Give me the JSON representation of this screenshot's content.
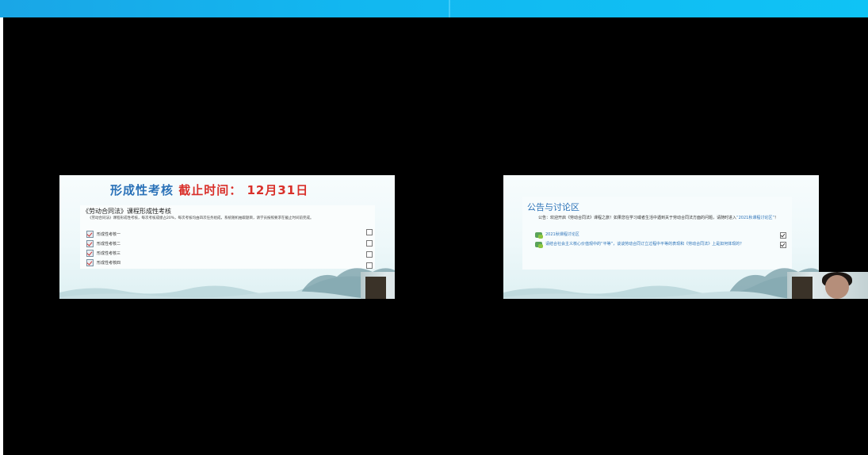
{
  "left_slide": {
    "title_main": "形成性考核",
    "title_deadline": "截止时间： 12月31日",
    "course_heading": "《劳动合同法》课程形成性考核",
    "description": "《劳动合同法》课程形成性考核，每次考核成绩占20%，每次考核均由四次任务组成，系统随机抽取题目，请学员按照要求在截止时间前完成。",
    "tasks": [
      "形成性考核一",
      "形成性考核二",
      "形成性考核三",
      "形成性考核四"
    ]
  },
  "right_slide": {
    "title": "公告与讨论区",
    "notice": "公告：欢迎开启《劳动合同法》课程之旅！如果您在学习或者生活中遇到关于劳动合同法方面的问题，请随时进入",
    "notice_link": "“2021秋课程讨论区”",
    "notice_end": "！",
    "items": [
      "2021秋课程讨论区",
      "请结合社会主义核心价值观中的“平等”，谈谈劳动合同订立过程中平等的表现和《劳动合同法》上是如何体现的？"
    ]
  }
}
